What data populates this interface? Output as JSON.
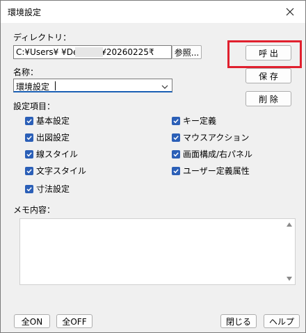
{
  "window": {
    "title": "環境設定"
  },
  "directory": {
    "label": "ディレクトリ：",
    "value": "C:¥Users¥         ¥Desktop¥20260225₹",
    "browse_label": "参照..."
  },
  "buttons": {
    "call": "呼 出",
    "save": "保 存",
    "delete": "削 除"
  },
  "name": {
    "label": "名称：",
    "value": "環境設定"
  },
  "settings": {
    "label": "設定項目：",
    "left": [
      "基本設定",
      "出図設定",
      "線スタイル",
      "文字スタイル",
      "寸法設定"
    ],
    "right": [
      "キー定義",
      "マウスアクション",
      "画面構成/右パネル",
      "ユーザー定義属性"
    ]
  },
  "memo": {
    "label": "メモ内容：",
    "value": ""
  },
  "footer": {
    "all_on": "全ON",
    "all_off": "全OFF",
    "close": "閉じる",
    "help": "ヘルプ"
  },
  "colors": {
    "check": "#2b5fb7",
    "highlight": "#e0202e"
  }
}
